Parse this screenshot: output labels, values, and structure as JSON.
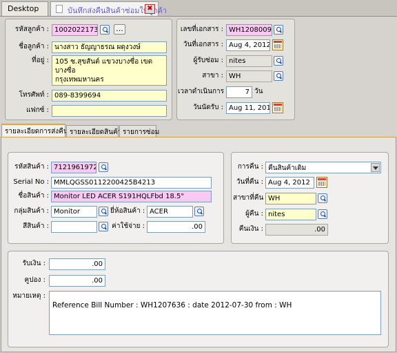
{
  "tabs": {
    "desktop": "Desktop",
    "document": "บันทึกส่งคืนสินค้าซ่อมให้ลูกค้า",
    "close": "✖"
  },
  "customer": {
    "code_label": "รหัสลูกค้า :",
    "code": "100202217306",
    "more_button": "...",
    "name_label": "ชื่อลูกค้า :",
    "name": "นางสาว ธัญญาธรณ  ผดุงวงษ์",
    "address_label": "ที่อยู่ :",
    "address_line1": "105 ซ.สุขสันต์ แขวงบางซื่อ เขตบางซื่อ",
    "address_line2": "กรุงเทพมหานคร",
    "phone_label": "โทรศัพท์ :",
    "phone": "089-8399694",
    "fax_label": "แฟกซ์ :",
    "fax": ""
  },
  "document": {
    "docno_label": "เลขที่เอกสาร :",
    "docno": "WH1208009",
    "docdate_label": "วันที่เอกสาร :",
    "docdate": "Aug 4, 2012",
    "repairer_label": "ผู้รับซ่อม :",
    "repairer": "nites",
    "branch_label": "สาขา :",
    "branch": "WH",
    "duration_label": "เวลาดำเนินการ :",
    "duration": "7",
    "duration_unit": "วัน",
    "appt_label": "วันนัดรับ :",
    "appt": "Aug 11, 2012"
  },
  "section_tabs": [
    "รายละเอียดการส่งคืน",
    "รายละเอียดสินค้า",
    "รายการซ่อม"
  ],
  "product": {
    "code_label": "รหัสสินค้า :",
    "code": "712196197254",
    "serial_label": "Serial No :",
    "serial": "MMLQGSS0112200425B4213",
    "name_label": "ชื่อสินค้า :",
    "name": "Monitor LED ACER S191HQLFbd 18.5\"",
    "group_label": "กลุ่มสินค้า :",
    "group": "Monitor",
    "brand_label": "ยี่ห้อสินค้า :",
    "brand": "ACER",
    "color_label": "สีสินค้า :",
    "color": "",
    "cost_label": "ค่าใช้จ่าย :",
    "cost": ".00"
  },
  "return": {
    "method_label": "การคืน :",
    "method": "คืนสินค้าเดิม",
    "date_label": "วันที่คืน :",
    "date": "Aug 4, 2012",
    "branch_label": "สาขาที่คืน :",
    "branch": "WH",
    "returner_label": "ผู้คืน :",
    "returner": "nites",
    "refund_label": "คืนเงิน :",
    "refund": ".00"
  },
  "payment": {
    "received_label": "รับเงิน :",
    "received": ".00",
    "coupon_label": "คูปอง :",
    "coupon": ".00",
    "remark_label": "หมายเหตุ :",
    "remark": "Reference Bill Number : WH1207636 : date 2012-07-30 from : WH"
  }
}
